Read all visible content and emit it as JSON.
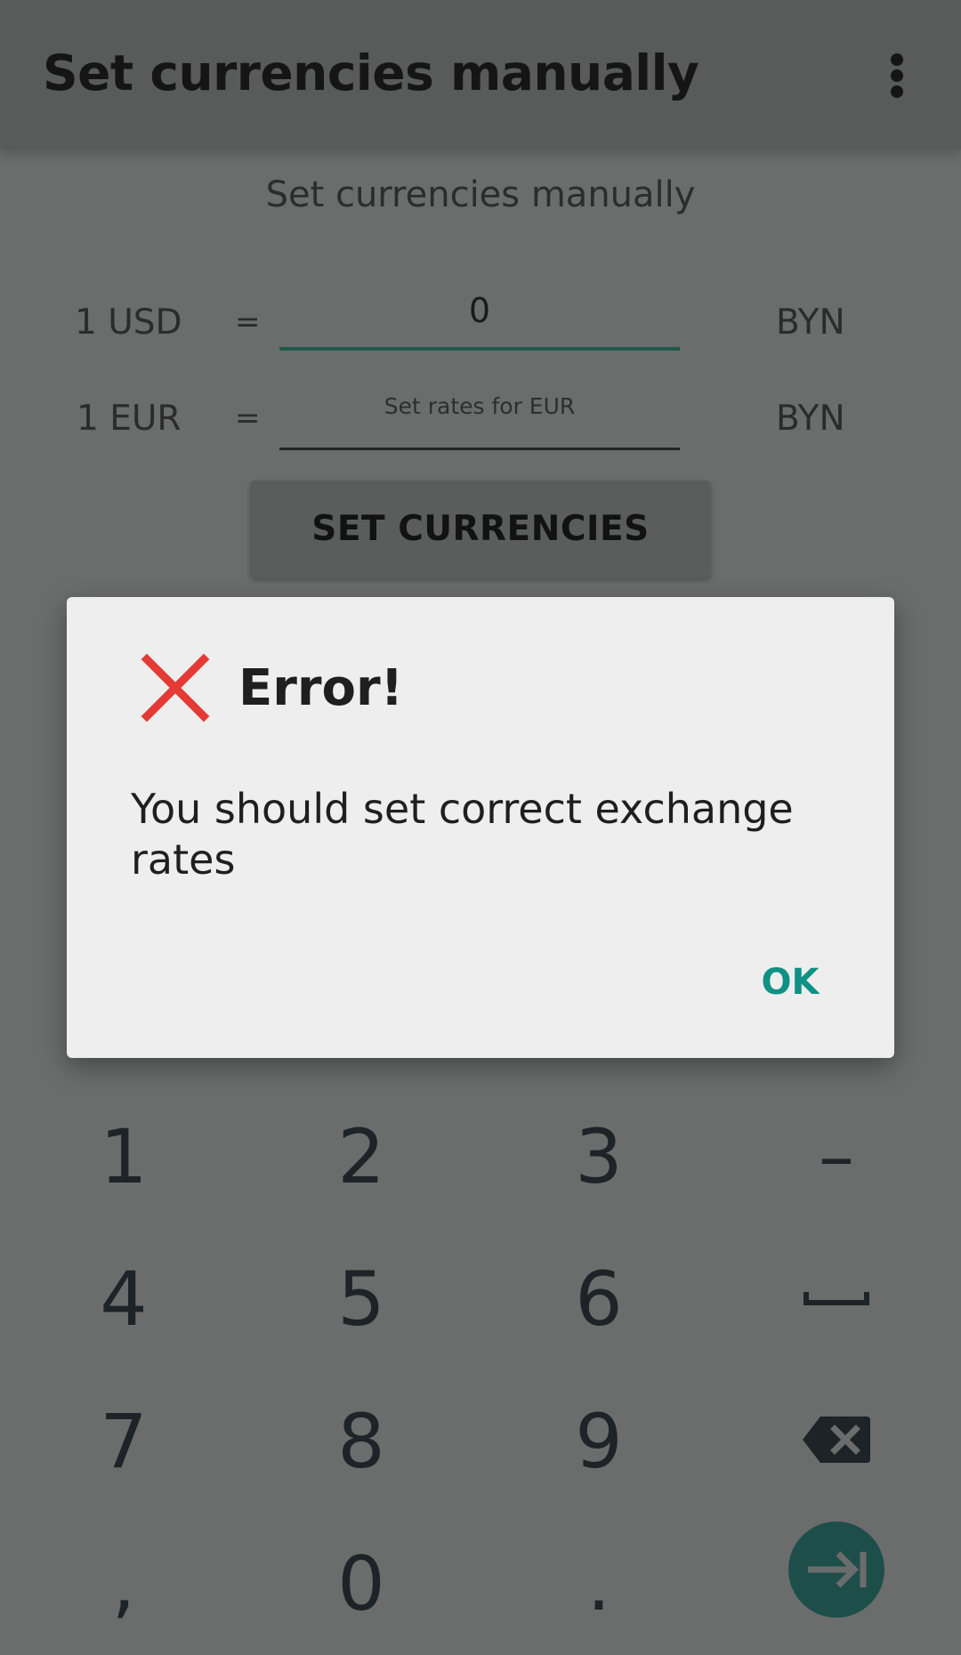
{
  "app_bar": {
    "title": "Set currencies manually",
    "menu_icon": "more-vert-icon"
  },
  "form": {
    "subtitle": "Set currencies manually",
    "rows": [
      {
        "label": "1 USD",
        "equals": "=",
        "value": "0",
        "placeholder": "",
        "currency": "BYN"
      },
      {
        "label": "1 EUR",
        "equals": "=",
        "value": "",
        "placeholder": "Set rates for EUR",
        "currency": "BYN"
      }
    ],
    "button_label": "SET CURRENCIES"
  },
  "dialog": {
    "icon": "error-x-icon",
    "icon_color": "#e53935",
    "title": "Error!",
    "message": "You should set correct exchange rates",
    "ok_label": "OK",
    "accent_color": "#0f9185"
  },
  "keypad": {
    "keys": [
      "1",
      "2",
      "3",
      "–",
      "4",
      "5",
      "6",
      "7",
      "8",
      "9",
      ",",
      "0",
      "."
    ],
    "space_icon": "space-icon",
    "backspace_icon": "backspace-icon",
    "next_icon": "next-field-icon"
  }
}
